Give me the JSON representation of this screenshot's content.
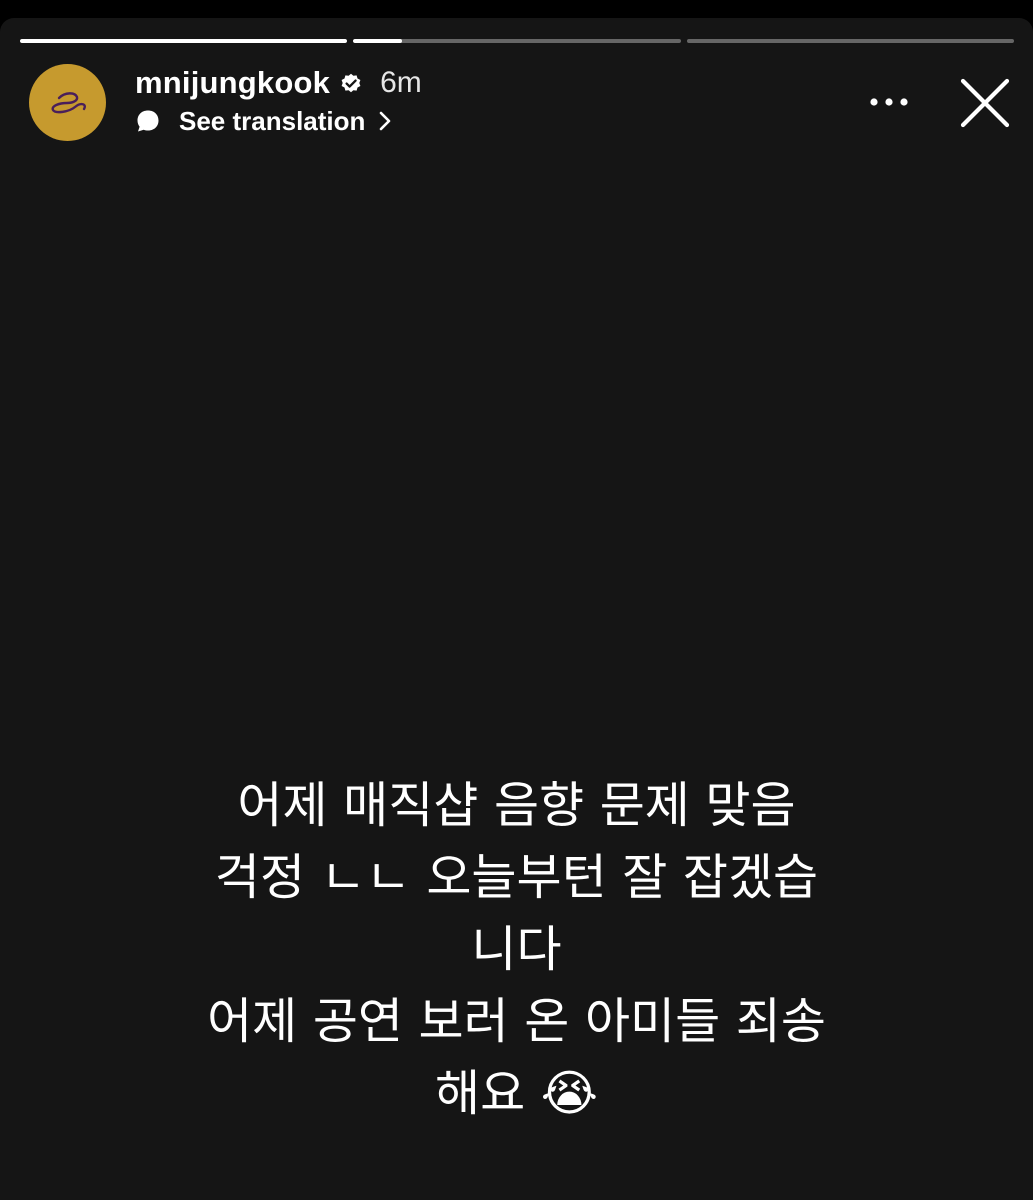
{
  "story": {
    "progress": [
      {
        "label": "segment 1",
        "fill": 1.0
      },
      {
        "label": "segment 2",
        "fill": 0.15
      },
      {
        "label": "segment 3",
        "fill": 0.0
      }
    ],
    "username": "mnijungkook",
    "verified": true,
    "time_ago": "6m",
    "translate_label": "See translation",
    "caption_lines": [
      "어제 매직샵 음향 문제 맞음",
      "걱정 ㄴㄴ 오늘부턴 잘 잡겠습",
      "니다",
      "어제 공연 보러 온 아미들 죄송",
      "해요 😭"
    ]
  },
  "colors": {
    "background": "#000000",
    "story_background": "#151515",
    "avatar_background": "#c69a2e",
    "avatar_mark": "#4a1f5a",
    "text": "#ffffff",
    "progress_track": "rgba(255,255,255,0.35)"
  },
  "icons": {
    "avatar_logo": "swirl-logo",
    "verified": "verified-badge-icon",
    "translate": "speech-bubble-icon",
    "chevron": "chevron-right-icon",
    "more": "more-dots-icon",
    "close": "close-icon"
  }
}
